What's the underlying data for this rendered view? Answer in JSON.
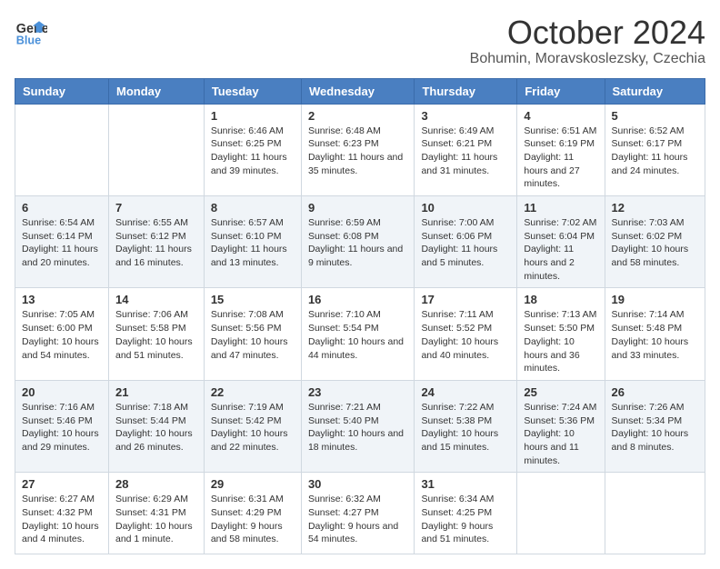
{
  "header": {
    "logo_line1": "General",
    "logo_line2": "Blue",
    "month": "October 2024",
    "location": "Bohumin, Moravskoslezsky, Czechia"
  },
  "days_of_week": [
    "Sunday",
    "Monday",
    "Tuesday",
    "Wednesday",
    "Thursday",
    "Friday",
    "Saturday"
  ],
  "weeks": [
    [
      {
        "day": "",
        "info": ""
      },
      {
        "day": "",
        "info": ""
      },
      {
        "day": "1",
        "info": "Sunrise: 6:46 AM\nSunset: 6:25 PM\nDaylight: 11 hours and 39 minutes."
      },
      {
        "day": "2",
        "info": "Sunrise: 6:48 AM\nSunset: 6:23 PM\nDaylight: 11 hours and 35 minutes."
      },
      {
        "day": "3",
        "info": "Sunrise: 6:49 AM\nSunset: 6:21 PM\nDaylight: 11 hours and 31 minutes."
      },
      {
        "day": "4",
        "info": "Sunrise: 6:51 AM\nSunset: 6:19 PM\nDaylight: 11 hours and 27 minutes."
      },
      {
        "day": "5",
        "info": "Sunrise: 6:52 AM\nSunset: 6:17 PM\nDaylight: 11 hours and 24 minutes."
      }
    ],
    [
      {
        "day": "6",
        "info": "Sunrise: 6:54 AM\nSunset: 6:14 PM\nDaylight: 11 hours and 20 minutes."
      },
      {
        "day": "7",
        "info": "Sunrise: 6:55 AM\nSunset: 6:12 PM\nDaylight: 11 hours and 16 minutes."
      },
      {
        "day": "8",
        "info": "Sunrise: 6:57 AM\nSunset: 6:10 PM\nDaylight: 11 hours and 13 minutes."
      },
      {
        "day": "9",
        "info": "Sunrise: 6:59 AM\nSunset: 6:08 PM\nDaylight: 11 hours and 9 minutes."
      },
      {
        "day": "10",
        "info": "Sunrise: 7:00 AM\nSunset: 6:06 PM\nDaylight: 11 hours and 5 minutes."
      },
      {
        "day": "11",
        "info": "Sunrise: 7:02 AM\nSunset: 6:04 PM\nDaylight: 11 hours and 2 minutes."
      },
      {
        "day": "12",
        "info": "Sunrise: 7:03 AM\nSunset: 6:02 PM\nDaylight: 10 hours and 58 minutes."
      }
    ],
    [
      {
        "day": "13",
        "info": "Sunrise: 7:05 AM\nSunset: 6:00 PM\nDaylight: 10 hours and 54 minutes."
      },
      {
        "day": "14",
        "info": "Sunrise: 7:06 AM\nSunset: 5:58 PM\nDaylight: 10 hours and 51 minutes."
      },
      {
        "day": "15",
        "info": "Sunrise: 7:08 AM\nSunset: 5:56 PM\nDaylight: 10 hours and 47 minutes."
      },
      {
        "day": "16",
        "info": "Sunrise: 7:10 AM\nSunset: 5:54 PM\nDaylight: 10 hours and 44 minutes."
      },
      {
        "day": "17",
        "info": "Sunrise: 7:11 AM\nSunset: 5:52 PM\nDaylight: 10 hours and 40 minutes."
      },
      {
        "day": "18",
        "info": "Sunrise: 7:13 AM\nSunset: 5:50 PM\nDaylight: 10 hours and 36 minutes."
      },
      {
        "day": "19",
        "info": "Sunrise: 7:14 AM\nSunset: 5:48 PM\nDaylight: 10 hours and 33 minutes."
      }
    ],
    [
      {
        "day": "20",
        "info": "Sunrise: 7:16 AM\nSunset: 5:46 PM\nDaylight: 10 hours and 29 minutes."
      },
      {
        "day": "21",
        "info": "Sunrise: 7:18 AM\nSunset: 5:44 PM\nDaylight: 10 hours and 26 minutes."
      },
      {
        "day": "22",
        "info": "Sunrise: 7:19 AM\nSunset: 5:42 PM\nDaylight: 10 hours and 22 minutes."
      },
      {
        "day": "23",
        "info": "Sunrise: 7:21 AM\nSunset: 5:40 PM\nDaylight: 10 hours and 18 minutes."
      },
      {
        "day": "24",
        "info": "Sunrise: 7:22 AM\nSunset: 5:38 PM\nDaylight: 10 hours and 15 minutes."
      },
      {
        "day": "25",
        "info": "Sunrise: 7:24 AM\nSunset: 5:36 PM\nDaylight: 10 hours and 11 minutes."
      },
      {
        "day": "26",
        "info": "Sunrise: 7:26 AM\nSunset: 5:34 PM\nDaylight: 10 hours and 8 minutes."
      }
    ],
    [
      {
        "day": "27",
        "info": "Sunrise: 6:27 AM\nSunset: 4:32 PM\nDaylight: 10 hours and 4 minutes."
      },
      {
        "day": "28",
        "info": "Sunrise: 6:29 AM\nSunset: 4:31 PM\nDaylight: 10 hours and 1 minute."
      },
      {
        "day": "29",
        "info": "Sunrise: 6:31 AM\nSunset: 4:29 PM\nDaylight: 9 hours and 58 minutes."
      },
      {
        "day": "30",
        "info": "Sunrise: 6:32 AM\nSunset: 4:27 PM\nDaylight: 9 hours and 54 minutes."
      },
      {
        "day": "31",
        "info": "Sunrise: 6:34 AM\nSunset: 4:25 PM\nDaylight: 9 hours and 51 minutes."
      },
      {
        "day": "",
        "info": ""
      },
      {
        "day": "",
        "info": ""
      }
    ]
  ]
}
